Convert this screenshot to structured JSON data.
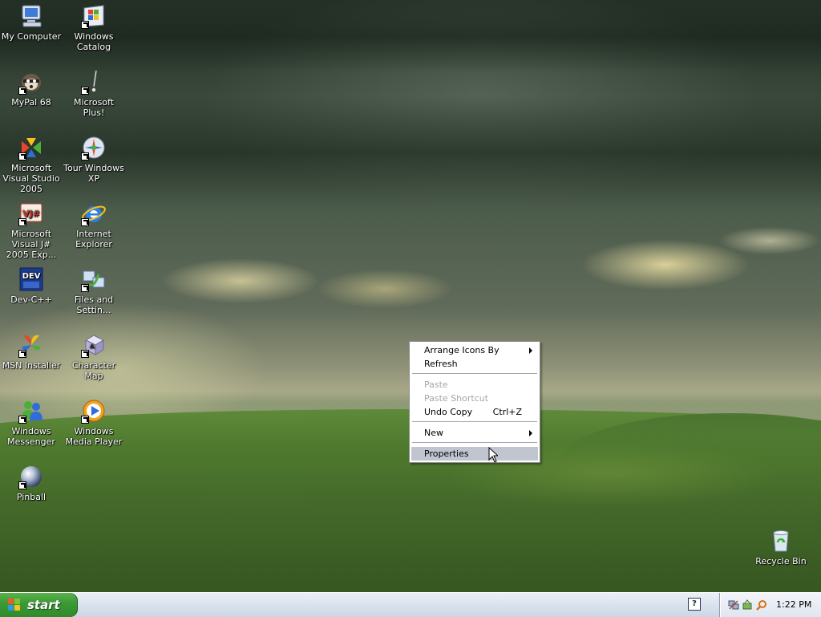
{
  "desktop": {
    "icons": [
      {
        "label": "My Computer",
        "icon": "my-computer-icon"
      },
      {
        "label": "Windows Catalog",
        "icon": "windows-catalog-icon"
      },
      {
        "label": "MyPal 68",
        "icon": "mypal-icon"
      },
      {
        "label": "Microsoft Plus!",
        "icon": "microsoft-plus-icon"
      },
      {
        "label": "Microsoft Visual Studio 2005",
        "icon": "visual-studio-icon"
      },
      {
        "label": "Tour Windows XP",
        "icon": "tour-windows-icon"
      },
      {
        "label": "Microsoft Visual J# 2005 Exp...",
        "icon": "visual-jsharp-icon"
      },
      {
        "label": "Internet Explorer",
        "icon": "internet-explorer-icon"
      },
      {
        "label": "Dev-C++",
        "icon": "dev-cpp-icon"
      },
      {
        "label": "Files and Settin...",
        "icon": "files-settings-icon"
      },
      {
        "label": "MSN Installer",
        "icon": "msn-installer-icon"
      },
      {
        "label": "Character Map",
        "icon": "character-map-icon"
      },
      {
        "label": "Windows Messenger",
        "icon": "windows-messenger-icon"
      },
      {
        "label": "Windows Media Player",
        "icon": "windows-media-player-icon"
      },
      {
        "label": "Pinball",
        "icon": "pinball-icon"
      },
      {
        "label": "Recycle Bin",
        "icon": "recycle-bin-icon"
      }
    ]
  },
  "context_menu": {
    "arrange_icons_by": "Arrange Icons By",
    "refresh": "Refresh",
    "paste": "Paste",
    "paste_shortcut": "Paste Shortcut",
    "undo_copy": "Undo Copy",
    "undo_copy_shortcut": "Ctrl+Z",
    "new": "New",
    "properties": "Properties"
  },
  "taskbar": {
    "start_label": "start",
    "help_label": "?",
    "clock": "1:22 PM"
  },
  "colors": {
    "menu_highlight": "#c1c5cf",
    "start_green": "#3e9a37",
    "disabled_text": "#a7a6aa"
  }
}
